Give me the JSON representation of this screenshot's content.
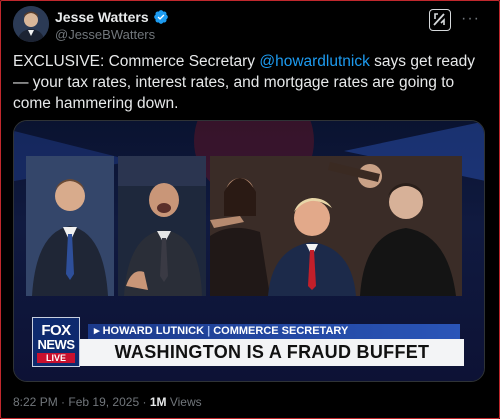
{
  "author": {
    "display_name": "Jesse Watters",
    "handle": "@JesseBWatters"
  },
  "tweet": {
    "text_prefix": "EXCLUSIVE: Commerce Secretary ",
    "mention": "@howardlutnick",
    "text_suffix": " says get ready — your tax rates, interest rates, and mortgage rates are going to come hammering down."
  },
  "media": {
    "logo_line1": "FOX",
    "logo_line2": "NEWS",
    "logo_line3": "LIVE",
    "subline_name": "HOWARD LUTNICK",
    "subline_sep": "|",
    "subline_title": "COMMERCE SECRETARY",
    "headline": "WASHINGTON IS A FRAUD BUFFET"
  },
  "meta": {
    "time": "8:22 PM",
    "dot1": "·",
    "date": "Feb 19, 2025",
    "dot2": "·",
    "views_count": "1M",
    "views_label": "Views"
  },
  "icons": {
    "verified": "verified-badge-icon",
    "grok": "grok-icon",
    "more": "more-icon"
  },
  "colors": {
    "accent": "#1d9bf0",
    "background": "#000000",
    "text": "#e7e9ea",
    "muted": "#71767b"
  }
}
